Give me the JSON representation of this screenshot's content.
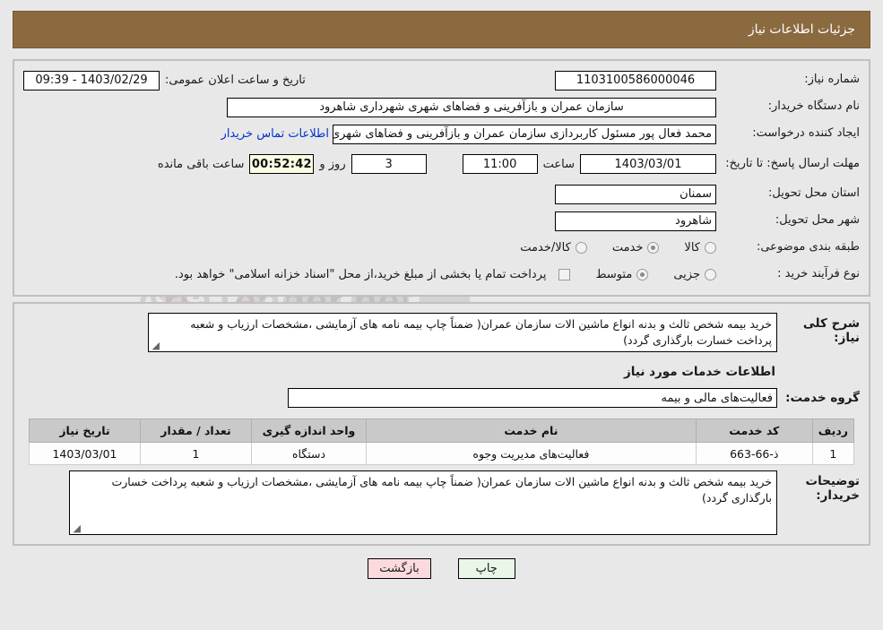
{
  "header": {
    "title": "جزئیات اطلاعات نیاز"
  },
  "watermark": {
    "text": "AriaTender.net"
  },
  "form": {
    "need_number": {
      "label": "شماره نیاز:",
      "value": "1103100586000046"
    },
    "public_announce": {
      "label": "تاریخ و ساعت اعلان عمومی:",
      "value": "1403/02/29 - 09:39"
    },
    "buyer_org": {
      "label": "نام دستگاه خریدار:",
      "value": "سازمان عمران و بازآفرینی و فضاهای شهری شهرداری شاهرود"
    },
    "creator": {
      "label": "ایجاد کننده درخواست:",
      "value": "محمد فعال پور مسئول کاربردازی سازمان عمران و بازآفرینی و فضاهای شهری ش",
      "contact_link": "اطلاعات تماس خریدار"
    },
    "deadline": {
      "label": "مهلت ارسال پاسخ: تا تاریخ:",
      "date": "1403/03/01",
      "hour_label": "ساعت",
      "hour": "11:00",
      "days": "3",
      "days_label": "روز و",
      "timer": "00:52:42",
      "timer_label": "ساعت باقی مانده"
    },
    "province": {
      "label": "استان محل تحویل:",
      "value": "سمنان"
    },
    "city": {
      "label": "شهر محل تحویل:",
      "value": "شاهرود"
    },
    "category": {
      "label": "طبقه بندی موضوعی:",
      "options": [
        {
          "label": "کالا",
          "checked": false
        },
        {
          "label": "خدمت",
          "checked": true
        },
        {
          "label": "کالا/خدمت",
          "checked": false
        }
      ]
    },
    "purchase_type": {
      "label": "نوع فرآیند خرید :",
      "options": [
        {
          "label": "جزیی",
          "checked": false
        },
        {
          "label": "متوسط",
          "checked": true
        }
      ],
      "checkbox_checked": false,
      "note": "پرداخت تمام یا بخشی از مبلغ خرید،از محل \"اسناد خزانه اسلامی\" خواهد بود."
    }
  },
  "description": {
    "need_label": "شرح کلی نیاز:",
    "need_value": "خرید بیمه شخص ثالث و بدنه انواع ماشین الات سازمان عمران( ضمناً چاپ بیمه نامه های آزمایشی ،مشخصات ارزیاب و شعبه پرداخت خسارت بارگذاری گردد)",
    "section_title": "اطلاعات خدمات مورد نیاز",
    "service_group_label": "گروه خدمت:",
    "service_group_value": "فعالیت‌های مالی و بیمه"
  },
  "table": {
    "headers": [
      "ردیف",
      "کد خدمت",
      "نام خدمت",
      "واحد اندازه گیری",
      "تعداد / مقدار",
      "تاریخ نیاز"
    ],
    "rows": [
      {
        "radif": "1",
        "code": "ذ-66-663",
        "name": "فعالیت‌های مدیریت وجوه",
        "unit": "دستگاه",
        "qty": "1",
        "date": "1403/03/01"
      }
    ]
  },
  "buyer_notes": {
    "label": "توضیحات خریدار:",
    "value": "خرید بیمه شخص ثالث و بدنه انواع ماشین الات سازمان عمران( ضمناً چاپ بیمه نامه های آزمایشی ،مشخصات ارزیاب و شعبه پرداخت خسارت بارگذاری گردد)"
  },
  "footer": {
    "print_label": "چاپ",
    "back_label": "بازگشت"
  },
  "colors": {
    "title_bar": "#8b6a40",
    "print_button": "#e8f7e8",
    "back_button": "#fadadd",
    "link": "#0033cc",
    "timer_bg": "#fbfbe3"
  }
}
